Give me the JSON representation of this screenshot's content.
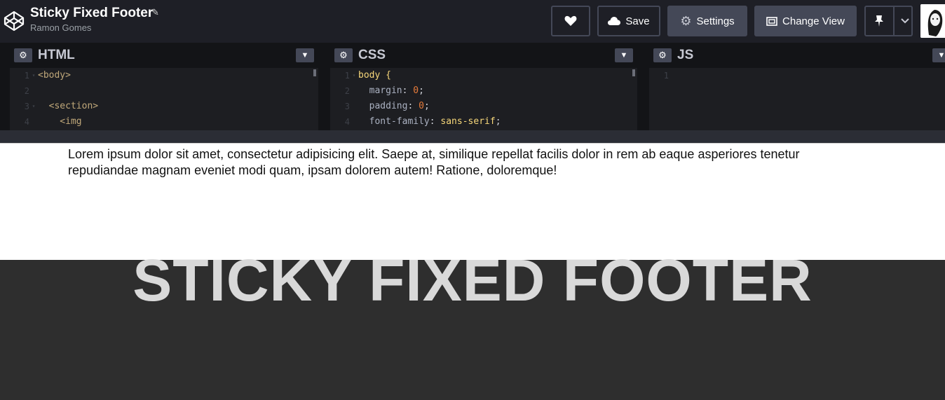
{
  "header": {
    "title": "Sticky Fixed Footer",
    "author": "Ramon Gomes",
    "save_label": "Save",
    "settings_label": "Settings",
    "change_view_label": "Change View"
  },
  "editors": {
    "html": {
      "name": "HTML",
      "lines": [
        {
          "n": "1",
          "fold": "▾",
          "code": "<body>"
        },
        {
          "n": "2",
          "fold": "",
          "code": ""
        },
        {
          "n": "3",
          "fold": "▾",
          "code": "  <section>"
        },
        {
          "n": "4",
          "fold": "",
          "code": "    <img"
        }
      ]
    },
    "css": {
      "name": "CSS",
      "lines": [
        {
          "n": "1",
          "fold": "▾",
          "code": "body {"
        },
        {
          "n": "2",
          "fold": "",
          "code": "  margin: 0;"
        },
        {
          "n": "3",
          "fold": "",
          "code": "  padding: 0;"
        },
        {
          "n": "4",
          "fold": "",
          "code": "  font-family: sans-serif;"
        }
      ]
    },
    "js": {
      "name": "JS",
      "lines": [
        {
          "n": "1",
          "fold": "",
          "code": ""
        }
      ]
    }
  },
  "preview": {
    "paragraph": "Lorem ipsum dolor sit amet, consectetur adipisicing elit. Saepe at, similique repellat facilis dolor in rem ab eaque asperiores tenetur repudiandae magnam eveniet modi quam, ipsam dolorem autem! Ratione, doloremque!",
    "footer_title": "STICKY FIXED FOOTER"
  },
  "colors": {
    "header_bg": "#1e1f26",
    "button_bg": "#444857",
    "footer_bg": "#2e2e2e",
    "footer_text": "#d9d9d9"
  },
  "icons": {
    "logo": "codepen-logo-icon",
    "edit": "pencil-icon",
    "heart": "heart-icon",
    "save": "cloud-icon",
    "settings": "gear-icon",
    "change_view": "layout-icon",
    "pin": "pin-icon",
    "chevron": "chevron-down-icon"
  }
}
